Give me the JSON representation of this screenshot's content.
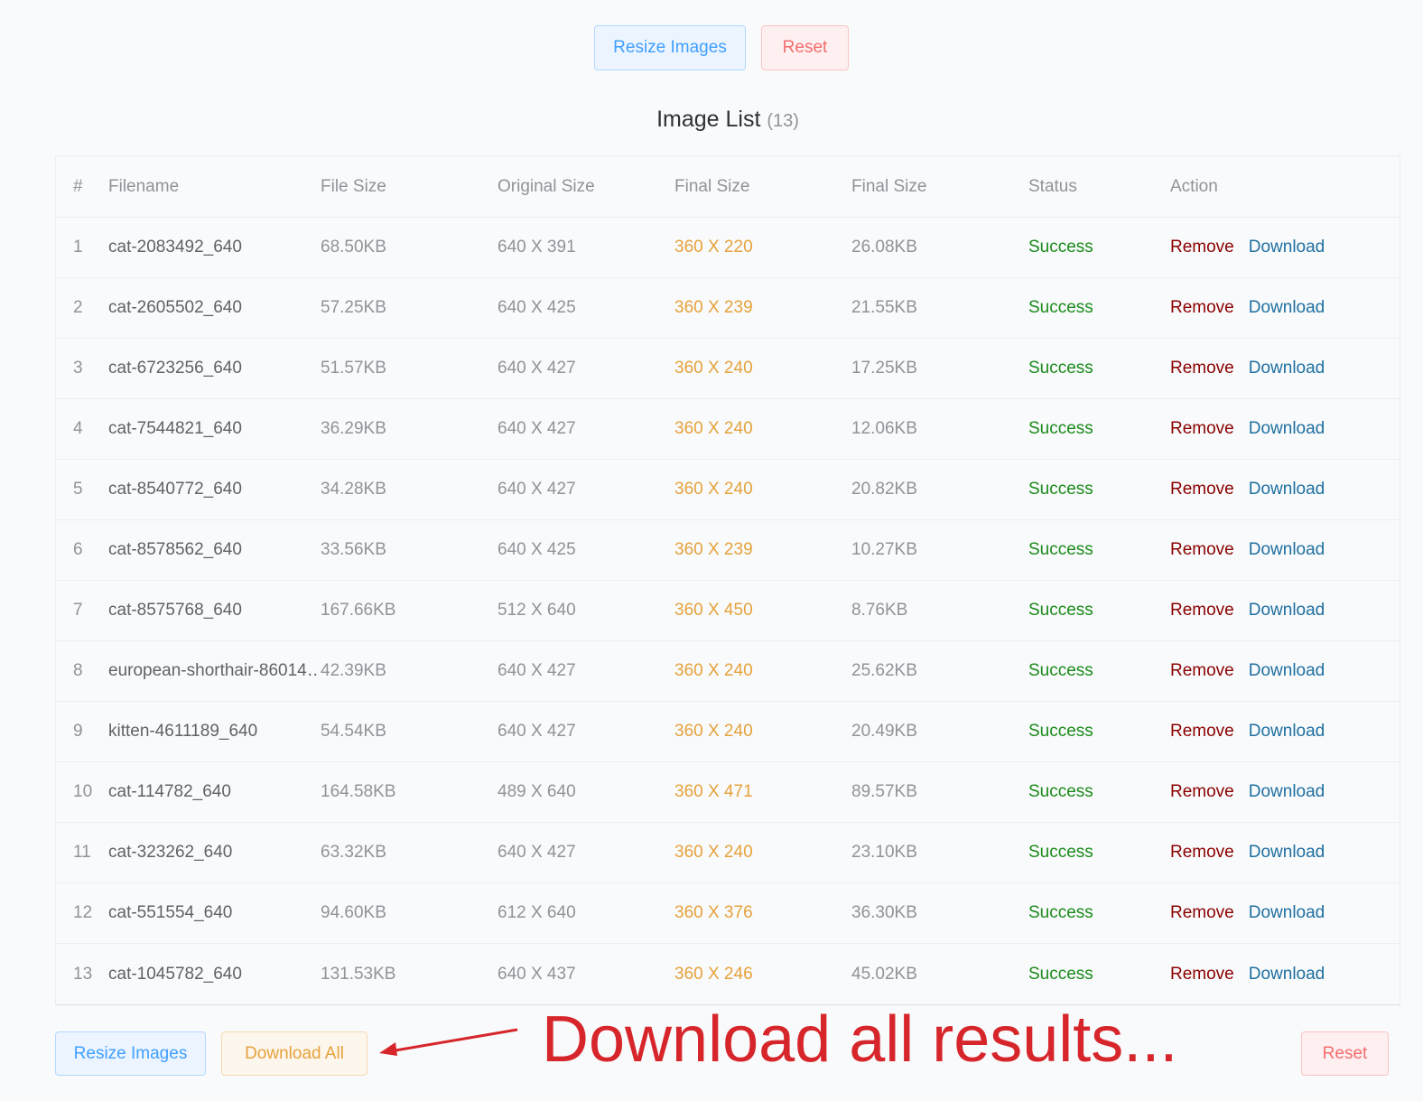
{
  "top_actions": {
    "resize_label": "Resize Images",
    "reset_label": "Reset"
  },
  "title": {
    "text": "Image List",
    "count": "(13)"
  },
  "table": {
    "headers": [
      "#",
      "Filename",
      "File Size",
      "Original Size",
      "Final Size",
      "Final Size",
      "Status",
      "Action"
    ],
    "rows": [
      {
        "idx": "1",
        "name": "cat-2083492_640",
        "size": "68.50KB",
        "orig": "640 X 391",
        "final": "360 X 220",
        "fsize": "26.08KB",
        "status": "Success",
        "remove": "Remove",
        "download": "Download"
      },
      {
        "idx": "2",
        "name": "cat-2605502_640",
        "size": "57.25KB",
        "orig": "640 X 425",
        "final": "360 X 239",
        "fsize": "21.55KB",
        "status": "Success",
        "remove": "Remove",
        "download": "Download"
      },
      {
        "idx": "3",
        "name": "cat-6723256_640",
        "size": "51.57KB",
        "orig": "640 X 427",
        "final": "360 X 240",
        "fsize": "17.25KB",
        "status": "Success",
        "remove": "Remove",
        "download": "Download"
      },
      {
        "idx": "4",
        "name": "cat-7544821_640",
        "size": "36.29KB",
        "orig": "640 X 427",
        "final": "360 X 240",
        "fsize": "12.06KB",
        "status": "Success",
        "remove": "Remove",
        "download": "Download"
      },
      {
        "idx": "5",
        "name": "cat-8540772_640",
        "size": "34.28KB",
        "orig": "640 X 427",
        "final": "360 X 240",
        "fsize": "20.82KB",
        "status": "Success",
        "remove": "Remove",
        "download": "Download"
      },
      {
        "idx": "6",
        "name": "cat-8578562_640",
        "size": "33.56KB",
        "orig": "640 X 425",
        "final": "360 X 239",
        "fsize": "10.27KB",
        "status": "Success",
        "remove": "Remove",
        "download": "Download"
      },
      {
        "idx": "7",
        "name": "cat-8575768_640",
        "size": "167.66KB",
        "orig": "512 X 640",
        "final": "360 X 450",
        "fsize": "8.76KB",
        "status": "Success",
        "remove": "Remove",
        "download": "Download"
      },
      {
        "idx": "8",
        "name": "european-shorthair-86014…",
        "size": "42.39KB",
        "orig": "640 X 427",
        "final": "360 X 240",
        "fsize": "25.62KB",
        "status": "Success",
        "remove": "Remove",
        "download": "Download"
      },
      {
        "idx": "9",
        "name": "kitten-4611189_640",
        "size": "54.54KB",
        "orig": "640 X 427",
        "final": "360 X 240",
        "fsize": "20.49KB",
        "status": "Success",
        "remove": "Remove",
        "download": "Download"
      },
      {
        "idx": "10",
        "name": "cat-114782_640",
        "size": "164.58KB",
        "orig": "489 X 640",
        "final": "360 X 471",
        "fsize": "89.57KB",
        "status": "Success",
        "remove": "Remove",
        "download": "Download"
      },
      {
        "idx": "11",
        "name": "cat-323262_640",
        "size": "63.32KB",
        "orig": "640 X 427",
        "final": "360 X 240",
        "fsize": "23.10KB",
        "status": "Success",
        "remove": "Remove",
        "download": "Download"
      },
      {
        "idx": "12",
        "name": "cat-551554_640",
        "size": "94.60KB",
        "orig": "612 X 640",
        "final": "360 X 376",
        "fsize": "36.30KB",
        "status": "Success",
        "remove": "Remove",
        "download": "Download"
      },
      {
        "idx": "13",
        "name": "cat-1045782_640",
        "size": "131.53KB",
        "orig": "640 X 437",
        "final": "360 X 246",
        "fsize": "45.02KB",
        "status": "Success",
        "remove": "Remove",
        "download": "Download"
      }
    ]
  },
  "bottom_actions": {
    "resize_label": "Resize Images",
    "download_all_label": "Download All",
    "reset_label": "Reset"
  },
  "annotation": {
    "text": "Download all results..."
  },
  "colors": {
    "final_size": "#e6a23c",
    "status_success": "#1a8a1a",
    "remove": "#8b0000",
    "download": "#1f6fa0",
    "annotation": "#d7262b"
  }
}
